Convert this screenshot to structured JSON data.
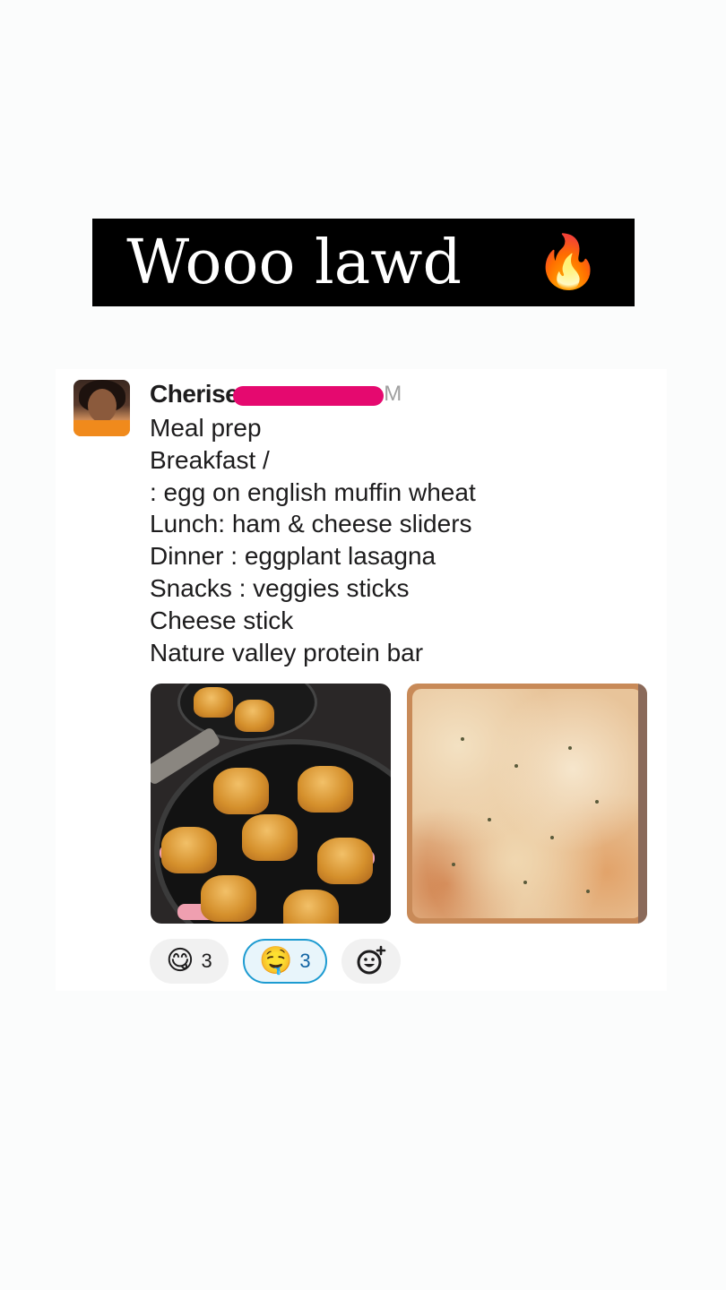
{
  "story_caption": {
    "text": "Wooo lawd",
    "emoji": [
      "😀",
      "🔥"
    ]
  },
  "message": {
    "author_first_name": "Cherise",
    "timestamp_visible_tail": "M",
    "lines": [
      "Meal prep",
      "Breakfast /",
      ": egg on english muffin wheat",
      "Lunch: ham & cheese sliders",
      "Dinner : eggplant lasagna",
      "Snacks : veggies sticks",
      "Cheese stick",
      "Nature valley protein bar"
    ]
  },
  "reactions": [
    {
      "emoji": "😋",
      "count": "3",
      "active": false
    },
    {
      "emoji": "🤤",
      "count": "3",
      "active": true
    }
  ],
  "colors": {
    "redaction": "#e5096f",
    "active_reaction_border": "#1d9bd1",
    "active_reaction_text": "#1264a3"
  }
}
